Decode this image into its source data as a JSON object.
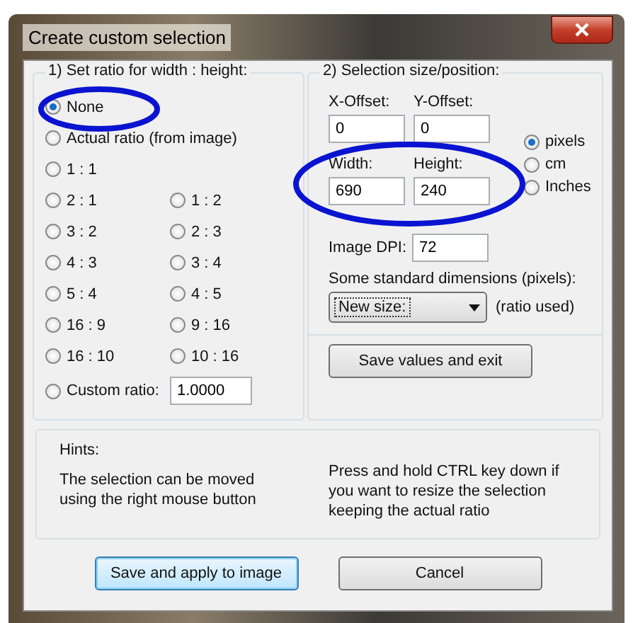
{
  "window": {
    "title": "Create custom selection"
  },
  "ratio_group": {
    "title": "1) Set ratio for width : height:",
    "rows": [
      [
        {
          "label": "None",
          "selected": true
        }
      ],
      [
        {
          "label": "Actual ratio (from image)",
          "selected": false
        }
      ],
      [
        {
          "label": "1 : 1",
          "selected": false
        }
      ],
      [
        {
          "label": "2 : 1",
          "selected": false
        },
        {
          "label": "1 : 2",
          "selected": false
        }
      ],
      [
        {
          "label": "3 : 2",
          "selected": false
        },
        {
          "label": "2 : 3",
          "selected": false
        }
      ],
      [
        {
          "label": "4 : 3",
          "selected": false
        },
        {
          "label": "3 : 4",
          "selected": false
        }
      ],
      [
        {
          "label": "5 : 4",
          "selected": false
        },
        {
          "label": "4 : 5",
          "selected": false
        }
      ],
      [
        {
          "label": "16 : 9",
          "selected": false
        },
        {
          "label": "9 : 16",
          "selected": false
        }
      ],
      [
        {
          "label": "16 : 10",
          "selected": false
        },
        {
          "label": "10 : 16",
          "selected": false
        }
      ]
    ],
    "custom": {
      "label": "Custom ratio:",
      "selected": false,
      "value": "1.0000"
    }
  },
  "size_group": {
    "title": "2) Selection size/position:",
    "fields": [
      {
        "label": "X-Offset:",
        "value": "0"
      },
      {
        "label": "Y-Offset:",
        "value": "0"
      },
      {
        "label": "Width:",
        "value": "690"
      },
      {
        "label": "Height:",
        "value": "240"
      }
    ],
    "units": [
      {
        "label": "pixels",
        "selected": true
      },
      {
        "label": "cm",
        "selected": false
      },
      {
        "label": "Inches",
        "selected": false
      }
    ],
    "dpi": {
      "label": "Image DPI:",
      "value": "72"
    },
    "standard_label": "Some standard dimensions (pixels):",
    "dropdown": {
      "value": "New size:"
    },
    "ratio_note": "(ratio used)",
    "save_button": "Save values and exit"
  },
  "hints": {
    "title": "Hints:",
    "left": "The selection can be moved using the right mouse button",
    "right": "Press and hold CTRL key down if you want to resize the selection keeping the actual ratio"
  },
  "buttons": [
    {
      "label": "Save and apply to image",
      "default": true
    },
    {
      "label": "Cancel",
      "default": false
    }
  ]
}
